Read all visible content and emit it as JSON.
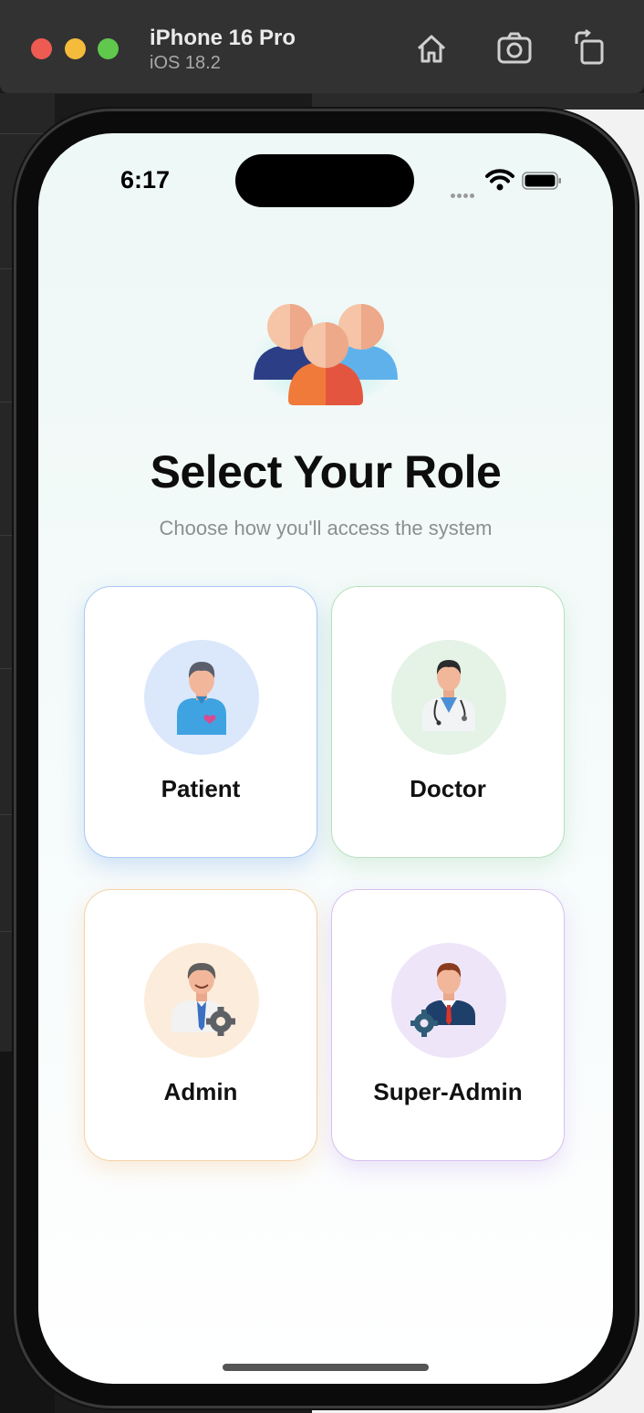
{
  "simulator": {
    "device_name": "iPhone 16 Pro",
    "os_version": "iOS 18.2",
    "buttons": [
      "home-icon",
      "screenshot-icon",
      "rotate-icon"
    ]
  },
  "status_bar": {
    "time": "6:17",
    "icons": [
      "signal-icon",
      "wifi-icon",
      "battery-icon"
    ]
  },
  "header": {
    "title": "Select Your Role",
    "subtitle": "Choose how you'll access the system"
  },
  "roles": [
    {
      "label": "Patient",
      "icon": "patient-icon",
      "accent": "#a9c9f2",
      "circle": "#dbe8fb"
    },
    {
      "label": "Doctor",
      "icon": "doctor-icon",
      "accent": "#b8e0bd",
      "circle": "#e4f3e6"
    },
    {
      "label": "Admin",
      "icon": "admin-icon",
      "accent": "#f4d3a8",
      "circle": "#fcecdb"
    },
    {
      "label": "Super-Admin",
      "icon": "super-admin-icon",
      "accent": "#d7c0ef",
      "circle": "#efe5f8"
    }
  ]
}
